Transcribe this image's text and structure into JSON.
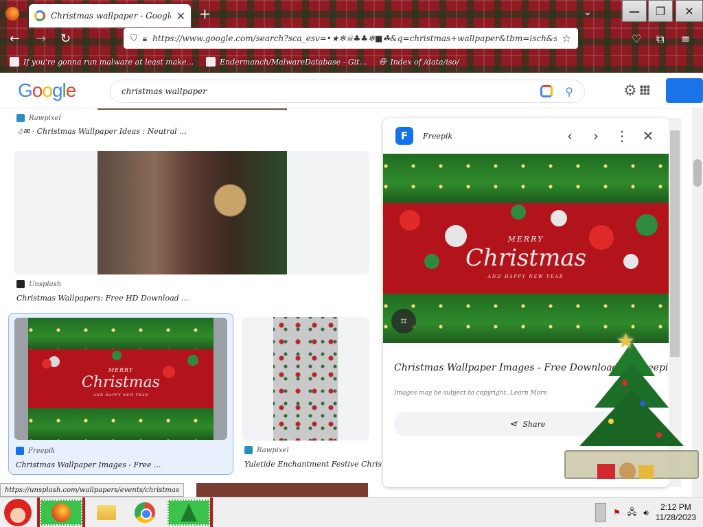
{
  "browser": {
    "tab_title": "Christmas wallpaper - Google Search",
    "url": "https://www.google.com/search?sca_esv=•★❄☠♣♣❄■☘&q=christmas+wallpaper&tbm=isch&source=lnms&",
    "bookmarks": [
      {
        "label": "If you're gonna run malware at least make..."
      },
      {
        "label": "Endermanch/MalwareDatabase - Git..."
      },
      {
        "label": "Index of /data/iso/"
      }
    ]
  },
  "google": {
    "logo": "Google",
    "query": "christmas wallpaper"
  },
  "results": {
    "item1": {
      "source": "Rawpixel",
      "caption": "☃✉ · Christmas Wallpaper Ideas : Neutral ..."
    },
    "item2": {
      "source": "Unsplash",
      "caption": "Christmas Wallpapers: Free HD Download ..."
    },
    "item3": {
      "source": "Freepik",
      "caption": "Christmas Wallpaper Images - Free ..."
    },
    "item4": {
      "source": "Rawpixel",
      "caption": "Yuletide Enchantment Festive Christmas ..."
    },
    "thumb_text": {
      "merry": "MERRY",
      "christmas": "Christmas",
      "sub": "AND HAPPY NEW YEAR"
    }
  },
  "preview": {
    "site": "Freepik",
    "title": "Christmas Wallpaper Images - Free Download on Freepik",
    "note": "Images may be subject to copyright. Learn More",
    "share_label": "Share",
    "img_text": {
      "merry": "MERRY",
      "christmas": "Christmas",
      "sub": "AND HAPPY NEW YEAR"
    }
  },
  "status": {
    "link": "https://unsplash.com/wallpapers/events/christmas"
  },
  "taskbar": {
    "time": "2:12 PM",
    "date": "11/28/2023"
  },
  "colors": {
    "google_blue": "#4285f4",
    "google_red": "#ea4335",
    "google_yellow": "#fbbc05",
    "google_green": "#34a853",
    "xmas_red": "#b3141b"
  }
}
